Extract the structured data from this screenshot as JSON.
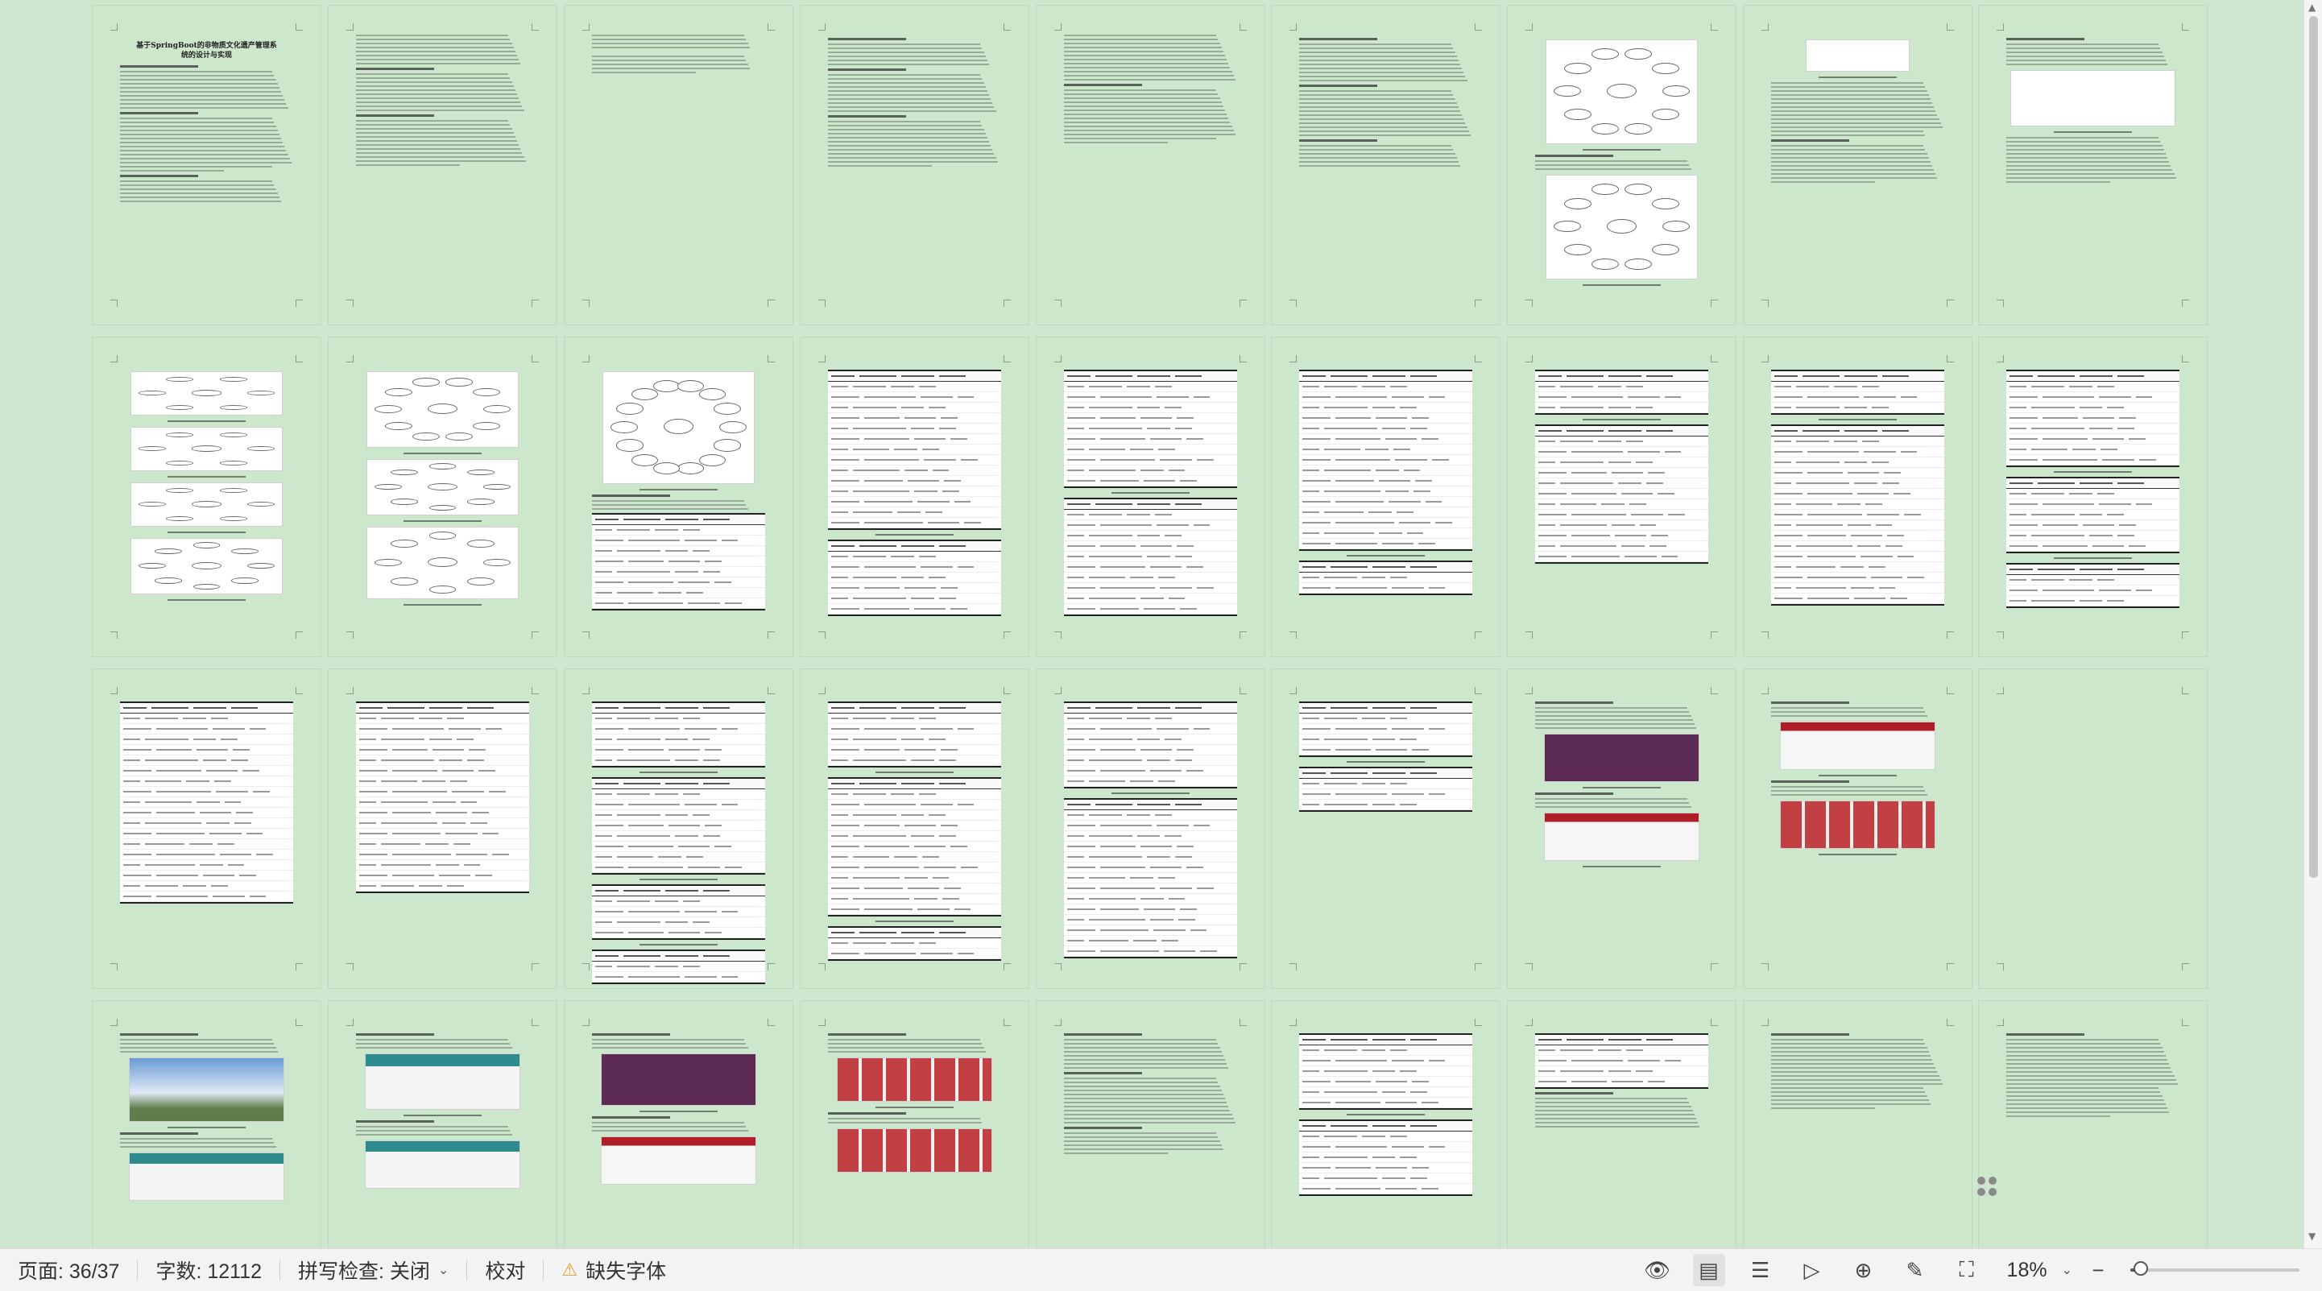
{
  "document": {
    "page1_title_line1": "基于SpringBoot的非物质文化遗产管理系",
    "page1_title_line2": "统的设计与实现"
  },
  "status_bar": {
    "page_info": "页面: 36/37",
    "word_count": "字数: 12112",
    "spell_check": "拼写检查: 关闭",
    "proofread": "校对",
    "missing_font": "缺失字体",
    "zoom": "18%",
    "zoom_level_fraction": 0.06
  },
  "icons": {
    "warning": "warning-icon",
    "view_modes": [
      "eye-icon",
      "page-view-icon",
      "outline-icon",
      "play-icon",
      "globe-icon",
      "pen-icon",
      "fit-icon"
    ]
  }
}
